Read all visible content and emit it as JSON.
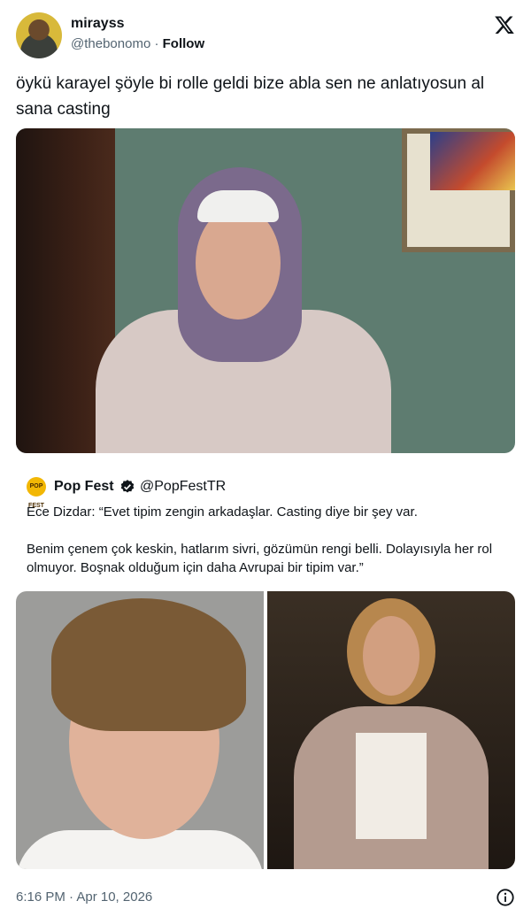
{
  "author": {
    "display_name": "mirayss",
    "handle": "@thebonomo",
    "separator": " · ",
    "follow_label": "Follow"
  },
  "tweet": {
    "text": "öykü karayel şöyle bi rolle geldi bize abla sen ne anlatıyosun al sana casting"
  },
  "quoted": {
    "avatar_text": "POP FEST",
    "name": "Pop Fest",
    "handle": "@PopFestTR",
    "paragraph_1": "Ece Dizdar: “Evet tipim zengin arkadaşlar. Casting diye bir şey var.",
    "paragraph_2": "Benim çenem çok keskin, hatlarım sivri, gözümün rengi belli. Dolayısıyla her rol olmuyor. Boşnak olduğum için daha Avrupai bir tipim var.”"
  },
  "footer": {
    "timestamp": "6:16 PM · Apr 10, 2026"
  },
  "icons": {
    "logo": "x-logo-icon",
    "verified": "verified-badge-icon",
    "info": "info-icon"
  },
  "colors": {
    "text": "#0f1419",
    "secondary": "#536471",
    "verified_badge": "#0f1419"
  }
}
